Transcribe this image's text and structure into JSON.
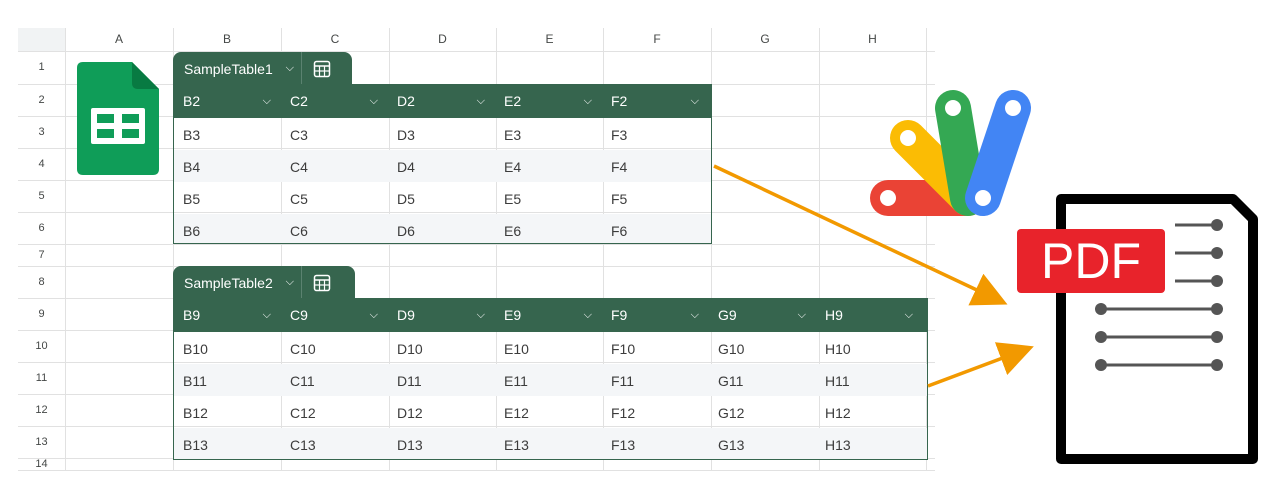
{
  "columns": [
    "A",
    "B",
    "C",
    "D",
    "E",
    "F",
    "G",
    "H"
  ],
  "rows": [
    "1",
    "2",
    "3",
    "4",
    "5",
    "6",
    "7",
    "8",
    "9",
    "10",
    "11",
    "12",
    "13",
    "14"
  ],
  "table1": {
    "name": "SampleTable1",
    "headers": [
      "B2",
      "C2",
      "D2",
      "E2",
      "F2"
    ],
    "rows": [
      [
        "B3",
        "C3",
        "D3",
        "E3",
        "F3"
      ],
      [
        "B4",
        "C4",
        "D4",
        "E4",
        "F4"
      ],
      [
        "B5",
        "C5",
        "D5",
        "E5",
        "F5"
      ],
      [
        "B6",
        "C6",
        "D6",
        "E6",
        "F6"
      ]
    ]
  },
  "table2": {
    "name": "SampleTable2",
    "headers": [
      "B9",
      "C9",
      "D9",
      "E9",
      "F9",
      "G9",
      "H9"
    ],
    "rows": [
      [
        "B10",
        "C10",
        "D10",
        "E10",
        "F10",
        "G10",
        "H10"
      ],
      [
        "B11",
        "C11",
        "D11",
        "E11",
        "F11",
        "G11",
        "H11"
      ],
      [
        "B12",
        "C12",
        "D12",
        "E12",
        "F12",
        "G12",
        "H12"
      ],
      [
        "B13",
        "C13",
        "D13",
        "E13",
        "F13",
        "G13",
        "H13"
      ]
    ]
  },
  "pdf_label": "PDF",
  "icons": {
    "sheets": "google-sheets-logo-icon",
    "apps_script": "apps-script-logo-icon",
    "pdf": "pdf-document-icon",
    "dropdown": "chevron-down-icon",
    "table": "table-settings-icon"
  },
  "colors": {
    "table_header": "#36654e",
    "arrow": "#f29900",
    "sheets_green": "#0f9d58",
    "pdf_red": "#e8232b"
  }
}
